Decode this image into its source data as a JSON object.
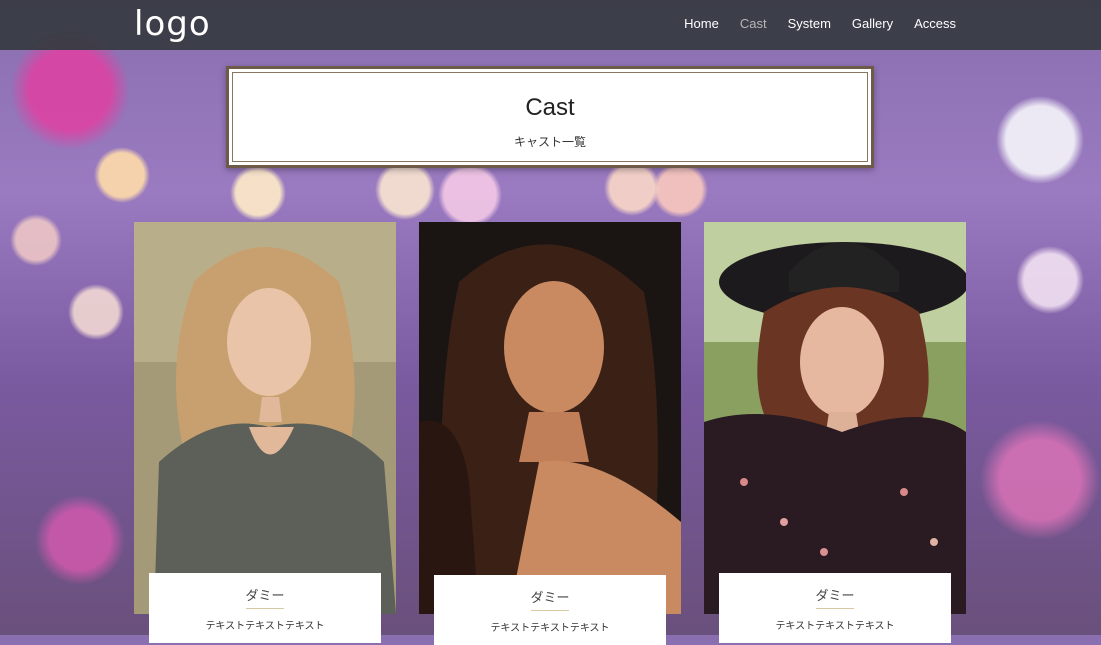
{
  "header": {
    "logo": "logo",
    "nav": [
      "Home",
      "Cast",
      "System",
      "Gallery",
      "Access"
    ],
    "active_nav": "Cast"
  },
  "page_title": {
    "title": "Cast",
    "subtitle": "キャスト一覧"
  },
  "cast": [
    {
      "name": "ダミー",
      "text": "テキストテキストテキスト"
    },
    {
      "name": "ダミー",
      "text": "テキストテキストテキスト"
    },
    {
      "name": "ダミー",
      "text": "テキストテキストテキスト"
    }
  ],
  "colors": {
    "header_bg": "#373a42",
    "accent_gold": "#d8c9a5",
    "title_border": "#6e5a48"
  }
}
